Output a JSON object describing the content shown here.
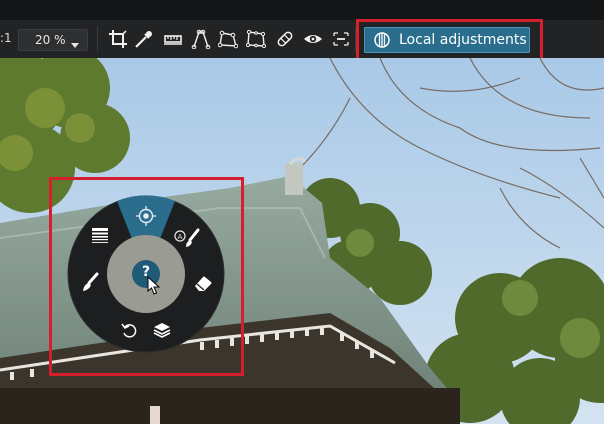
{
  "toolbar": {
    "zoom_prefix": ":1",
    "zoom_value": "20 %",
    "local_adjustments_label": "Local adjustments",
    "tools": [
      {
        "name": "crop-icon"
      },
      {
        "name": "color-picker-icon"
      },
      {
        "name": "straighten-icon"
      },
      {
        "name": "perspective-vertical-icon"
      },
      {
        "name": "perspective-rect-icon"
      },
      {
        "name": "perspective-eight-point-icon"
      },
      {
        "name": "repair-bandage-icon"
      },
      {
        "name": "red-eye-icon"
      },
      {
        "name": "watermark-icon"
      }
    ]
  },
  "radial_menu": {
    "center_label": "?",
    "items": [
      {
        "name": "control-point-icon"
      },
      {
        "name": "auto-mask-brush-icon"
      },
      {
        "name": "eraser-icon"
      },
      {
        "name": "layers-icon"
      },
      {
        "name": "undo-icon"
      },
      {
        "name": "brush-icon"
      },
      {
        "name": "graduated-filter-icon"
      }
    ]
  },
  "colors": {
    "accent": "#2a6d8d",
    "highlight": "#d3202c",
    "menu_dark": "#1d1e20",
    "menu_ring": "#9a9b93",
    "menu_selected": "#2a6d8d"
  }
}
